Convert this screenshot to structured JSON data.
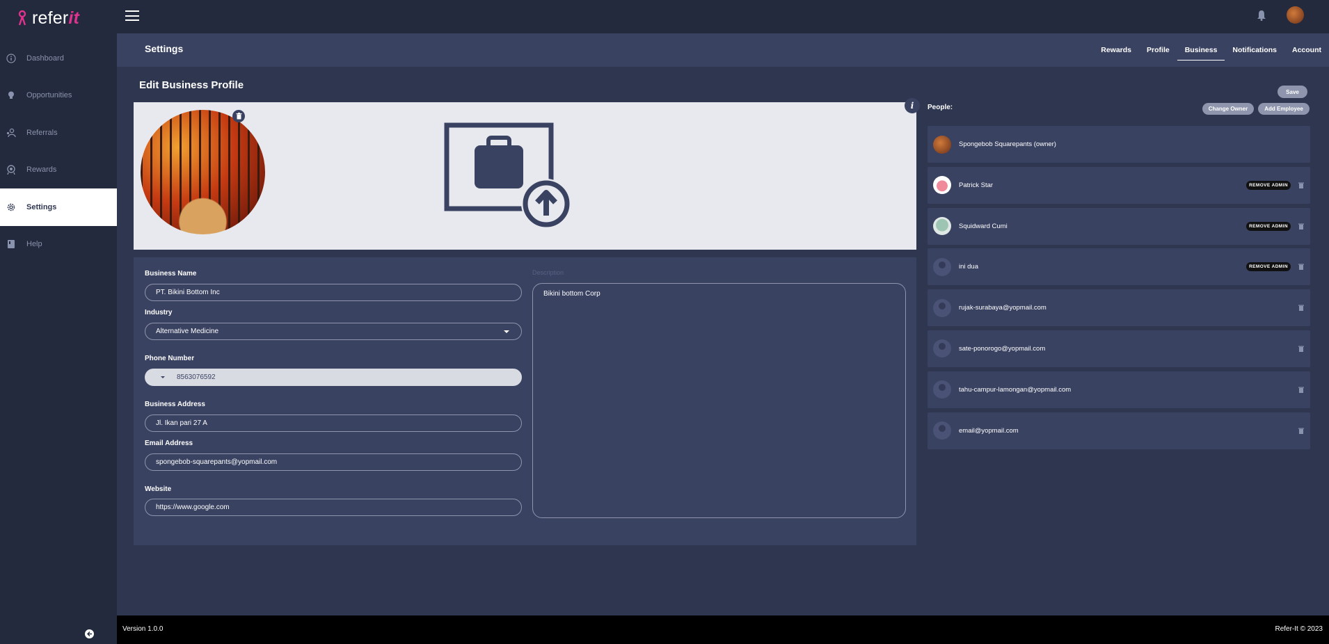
{
  "app": {
    "logo_text": "refer",
    "logo_accent": "it",
    "brand_color": "#e0338e"
  },
  "sidebar": {
    "items": [
      {
        "label": "Dashboard",
        "icon": "info-icon"
      },
      {
        "label": "Opportunities",
        "icon": "lightbulb-icon"
      },
      {
        "label": "Referrals",
        "icon": "referral-icon"
      },
      {
        "label": "Rewards",
        "icon": "rewards-icon"
      },
      {
        "label": "Settings",
        "icon": "gear-icon",
        "active": true
      },
      {
        "label": "Help",
        "icon": "book-icon"
      }
    ]
  },
  "header": {
    "section_title": "Settings",
    "tabs": [
      {
        "label": "Rewards"
      },
      {
        "label": "Profile"
      },
      {
        "label": "Business",
        "active": true
      },
      {
        "label": "Notifications"
      },
      {
        "label": "Account"
      }
    ]
  },
  "main": {
    "heading": "Edit Business Profile",
    "form": {
      "business_name": {
        "label": "Business Name",
        "value": "PT. Bikini Bottom Inc"
      },
      "industry": {
        "label": "Industry",
        "value": "Alternative Medicine"
      },
      "phone": {
        "label": "Phone Number",
        "value": "8563076592"
      },
      "address": {
        "label": "Business Address",
        "value": "Jl. Ikan pari 27 A"
      },
      "email": {
        "label": "Email Address",
        "value": "spongebob-squarepants@yopmail.com"
      },
      "website": {
        "label": "Website",
        "value": "https://www.google.com"
      },
      "description": {
        "label": "Description",
        "value": "Bikini bottom Corp"
      }
    }
  },
  "people": {
    "label": "People:",
    "save_label": "Save",
    "change_owner_label": "Change Owner",
    "add_employee_label": "Add Employee",
    "remove_admin_label": "REMOVE ADMIN",
    "list": [
      {
        "name": "Spongebob Squarepants (owner)",
        "avatar": "photo",
        "admin": false,
        "deletable": false
      },
      {
        "name": "Patrick Star",
        "avatar": "photo",
        "admin": true,
        "deletable": true
      },
      {
        "name": "Squidward Cumi",
        "avatar": "photo",
        "admin": true,
        "deletable": true
      },
      {
        "name": "ini dua",
        "avatar": "default",
        "admin": true,
        "deletable": true
      },
      {
        "name": "rujak-surabaya@yopmail.com",
        "avatar": "default",
        "admin": false,
        "deletable": true
      },
      {
        "name": "sate-ponorogo@yopmail.com",
        "avatar": "default",
        "admin": false,
        "deletable": true
      },
      {
        "name": "tahu-campur-lamongan@yopmail.com",
        "avatar": "default",
        "admin": false,
        "deletable": true
      },
      {
        "name": "email@yopmail.com",
        "avatar": "default",
        "admin": false,
        "deletable": true
      }
    ]
  },
  "footer": {
    "version": "Version 1.0.0",
    "copyright": "Refer-It © 2023"
  }
}
